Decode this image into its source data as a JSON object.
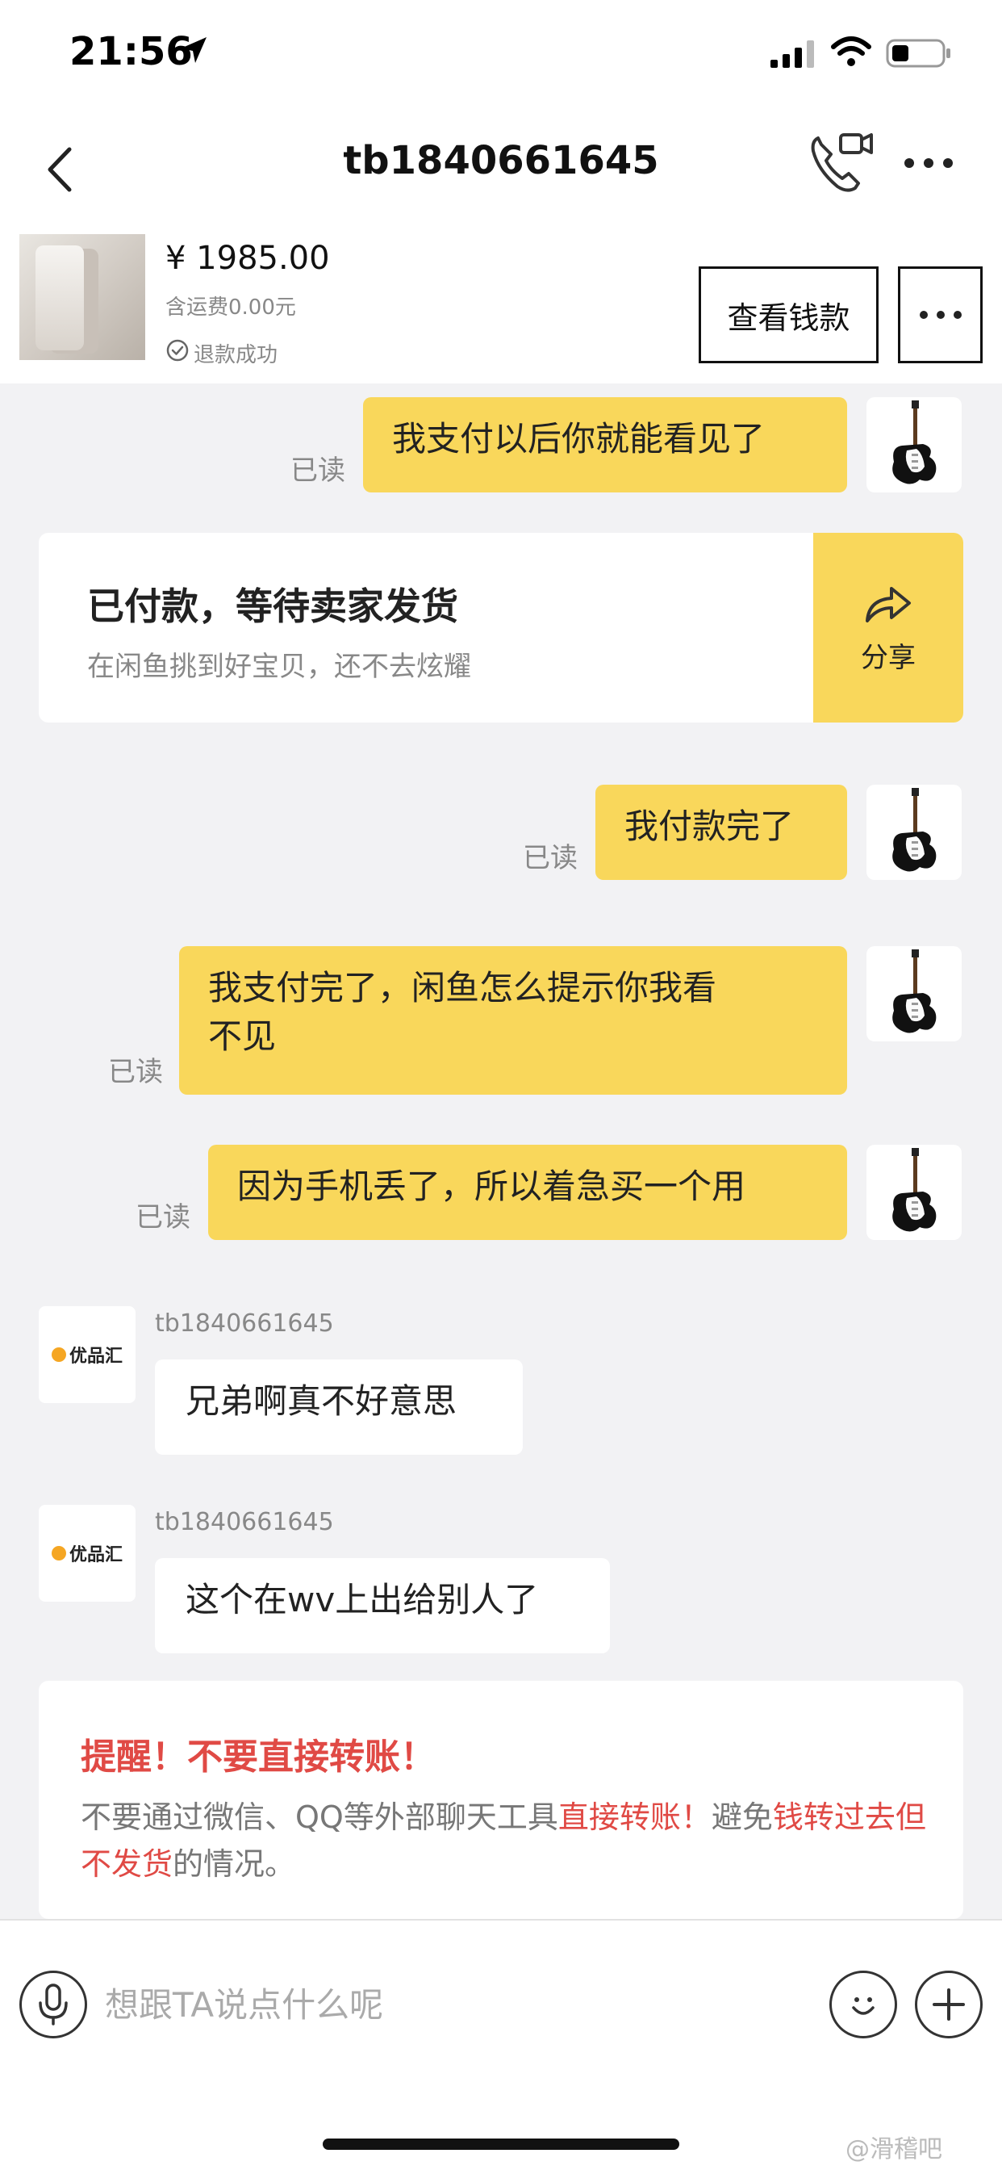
{
  "status_bar": {
    "time": "21:56",
    "icons": [
      "location-arrow-icon",
      "signal-icon",
      "wifi-icon",
      "battery-icon"
    ]
  },
  "nav": {
    "title": "tb1840661645",
    "back_icon": "chevron-left-icon",
    "call_icon": "phone-video-icon",
    "more_icon": "more-dots-icon"
  },
  "product": {
    "price": "¥ 1985.00",
    "shipping": "含运费0.00元",
    "status": "退款成功",
    "view_money_label": "查看钱款"
  },
  "messages": {
    "m1": {
      "text": "我支付以后你就能看见了",
      "read": "已读"
    },
    "paid_card": {
      "title": "已付款，等待卖家发货",
      "subtitle": "在闲鱼挑到好宝贝，还不去炫耀",
      "share_label": "分享"
    },
    "m2": {
      "text": "我付款完了",
      "read": "已读"
    },
    "m3": {
      "line1": "我支付完了，闲鱼怎么提示你我看",
      "line2": "不见",
      "read": "已读"
    },
    "m4": {
      "text": "因为手机丢了，所以着急买一个用",
      "read": "已读"
    },
    "m5": {
      "sender": "tb1840661645",
      "text": "兄弟啊真不好意思"
    },
    "m6": {
      "sender": "tb1840661645",
      "text": "这个在wv上出给别人了"
    },
    "shop_logo": "优品汇"
  },
  "warning": {
    "title": "提醒！不要直接转账！",
    "seg1": "不要通过微信、QQ等外部聊天工具",
    "seg2": "直接转账！",
    "seg3": "避免",
    "seg4": "钱转过去但不发货",
    "seg5": "的情况。"
  },
  "input": {
    "placeholder": "想跟TA说点什么呢"
  },
  "colors": {
    "bubble_out": "#f9d75b",
    "bubble_in": "#ffffff",
    "background": "#f2f2f4",
    "warning_red": "#e04a45"
  },
  "watermark": "@滑稽吧"
}
